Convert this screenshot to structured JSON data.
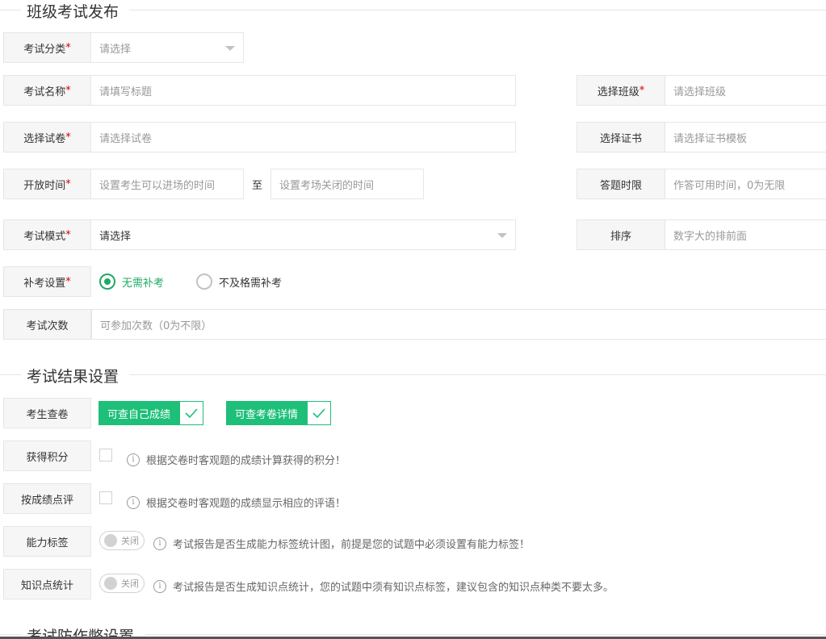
{
  "section1": {
    "title": "班级考试发布"
  },
  "fields": {
    "category": {
      "label": "考试分类",
      "placeholder": "请选择"
    },
    "name": {
      "label": "考试名称",
      "placeholder": "请填写标题"
    },
    "class": {
      "label": "选择班级",
      "placeholder": "请选择班级"
    },
    "paper": {
      "label": "选择试卷",
      "placeholder": "请选择试卷"
    },
    "certificate": {
      "label": "选择证书",
      "placeholder": "请选择证书模板"
    },
    "open_time": {
      "label": "开放时间",
      "start_placeholder": "设置考生可以进场的时间",
      "to": "至",
      "end_placeholder": "设置考场关闭的时间"
    },
    "time_limit": {
      "label": "答题时限",
      "placeholder": "作答可用时间，0为无限"
    },
    "mode": {
      "label": "考试模式",
      "value": "请选择"
    },
    "sort": {
      "label": "排序",
      "placeholder": "数字大的排前面"
    },
    "retake": {
      "label": "补考设置",
      "options": [
        "无需补考",
        "不及格需补考"
      ],
      "selected": 0
    },
    "attempts": {
      "label": "考试次数",
      "placeholder": "可参加次数（0为不限）"
    },
    "required_mark": "*"
  },
  "section2": {
    "title": "考试结果设置"
  },
  "results": {
    "review": {
      "label": "考生查卷",
      "options": [
        "可查自己成绩",
        "可查考卷详情"
      ]
    },
    "points": {
      "label": "获得积分",
      "tip": "根据交卷时客观题的成绩计算获得的积分！"
    },
    "comment": {
      "label": "按成绩点评",
      "tip": "根据交卷时客观题的成绩显示相应的评语！"
    },
    "ability": {
      "label": "能力标签",
      "switch": "关闭",
      "tip": "考试报告是否生成能力标签统计图，前提是您的试题中必须设置有能力标签！"
    },
    "knowledge": {
      "label": "知识点统计",
      "switch": "关闭",
      "tip": "考试报告是否生成知识点统计，您的试题中须有知识点标签，建议包含的知识点种类不要太多。"
    }
  },
  "section3": {
    "title": "考试防作弊设置"
  }
}
